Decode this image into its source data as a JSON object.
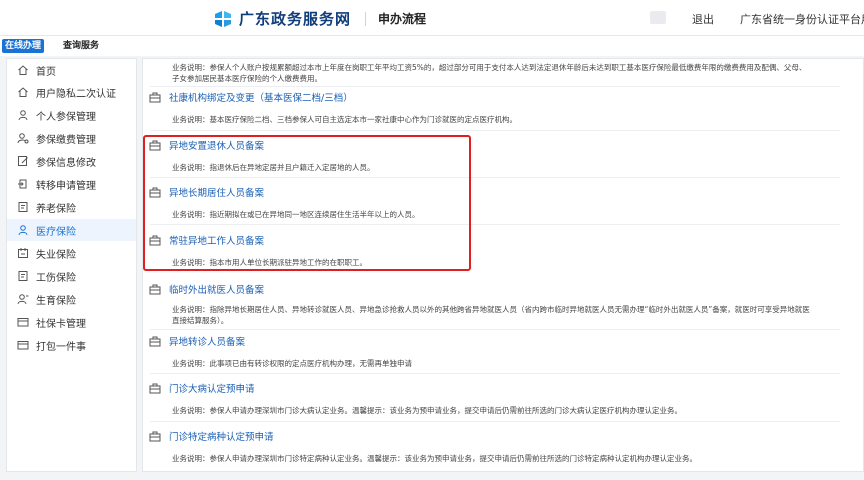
{
  "header": {
    "site_title": "广东政务服务网",
    "flow_title": "申办流程",
    "logout": "退出",
    "platform": "广东省统一身份认证平台用户中"
  },
  "tabs": [
    {
      "label": "在线办理"
    },
    {
      "label": "查询服务"
    }
  ],
  "sidebar": {
    "items": [
      {
        "label": "首页",
        "icon": "home-icon"
      },
      {
        "label": "用户隐私二次认证",
        "icon": "home-icon"
      },
      {
        "label": "个人参保管理",
        "icon": "person-icon"
      },
      {
        "label": "参保缴费管理",
        "icon": "person-gear-icon"
      },
      {
        "label": "参保信息修改",
        "icon": "edit-icon"
      },
      {
        "label": "转移申请管理",
        "icon": "transfer-icon"
      },
      {
        "label": "养老保险",
        "icon": "document-icon"
      },
      {
        "label": "医疗保险",
        "icon": "person-icon"
      },
      {
        "label": "失业保险",
        "icon": "calendar-icon"
      },
      {
        "label": "工伤保险",
        "icon": "document-icon"
      },
      {
        "label": "生育保险",
        "icon": "person-icon"
      },
      {
        "label": "社保卡管理",
        "icon": "card-icon"
      },
      {
        "label": "打包一件事",
        "icon": "card-icon"
      }
    ],
    "active_index": 7
  },
  "main": {
    "top_desc": "业务说明：参保人个人账户按规累额超过本市上年度在岗职工年平均工资5%的，超过部分可用于支付本人达到法定退休年龄后未达到职工基本医疗保险最低缴费年限的缴费费用及配偶、父母、子女参加居民基本医疗保险的个人缴费费用。",
    "services": [
      {
        "title": "社康机构绑定及变更（基本医保二档/三档）",
        "desc": "业务说明：基本医疗保险二档、三档参保人可自主选定本市一家社康中心作为门诊就医的定点医疗机构。"
      },
      {
        "title": "异地安置退休人员备案",
        "desc": "业务说明：指退休后在异地定居并且户籍迁入定居地的人员。"
      },
      {
        "title": "异地长期居住人员备案",
        "desc": "业务说明：指近期拟在或已在异地同一地区连续居住生活半年以上的人员。"
      },
      {
        "title": "常驻异地工作人员备案",
        "desc": "业务说明：指本市用人单位长期派驻异地工作的在职职工。"
      },
      {
        "title": "临时外出就医人员备案",
        "desc": "业务说明：指除异地长期居住人员、异地转诊就医人员、异地急诊抢救人员以外的其他跨省异地就医人员（省内跨市临时异地就医人员无需办理“临时外出就医人员”备案，就医时可享受异地就医直接结算服务）。"
      },
      {
        "title": "异地转诊人员备案",
        "desc": "业务说明：此事项已由有转诊权限的定点医疗机构办理，无需再单独申请"
      },
      {
        "title": "门诊大病认定预申请",
        "desc": "业务说明：参保人申请办理深圳市门诊大病认定业务。温馨提示：该业务为预申请业务，提交申请后仍需前往所选的门诊大病认定医疗机构办理认定业务。"
      },
      {
        "title": "门诊特定病种认定预申请",
        "desc": "业务说明：参保人申请办理深圳市门诊特定病种认定业务。温馨提示：该业务为预申请业务，提交申请后仍需前往所选的门诊特定病种认定机构办理认定业务。"
      }
    ]
  },
  "colors": {
    "brand": "#1a73d4",
    "link": "#1a5fb4",
    "highlight": "#e02020"
  }
}
